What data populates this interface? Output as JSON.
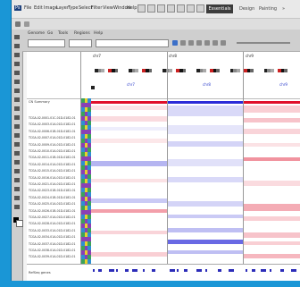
{
  "menubar": {
    "items": [
      "Ps",
      "File",
      "Edit",
      "Image",
      "Layer",
      "Type",
      "Select",
      "Filter",
      "View",
      "Window",
      "Help"
    ],
    "workspace_label": "Essentials",
    "workspace_items": [
      "Design",
      "Painting",
      "»"
    ]
  },
  "toolbar": {
    "tabs": [
      "Genome",
      "Go",
      "Tools",
      "Regions",
      "Help"
    ],
    "locus_value": "",
    "zoom_label": ""
  },
  "doc": {
    "chromosomes": [
      {
        "label": "chr7",
        "link": "chr7"
      },
      {
        "label": "chr8",
        "link": "chr8"
      },
      {
        "label": "chr9",
        "link": "chr9"
      }
    ],
    "cn_label": "CN Summary",
    "samples": [
      "TCGA-02-0001-01C-01D-0182-01",
      "TCGA-02-0003-01A-01D-0182-01",
      "TCGA-02-0006-01B-01D-0182-01",
      "TCGA-02-0007-01A-01D-0182-01",
      "TCGA-02-0009-01A-01D-0182-01",
      "TCGA-02-0010-01A-01D-0182-01",
      "TCGA-02-0011-01B-01D-0182-01",
      "TCGA-02-0014-01A-01D-0182-01",
      "TCGA-02-0015-01A-01D-0182-01",
      "TCGA-02-0016-01A-01D-0182-01",
      "TCGA-02-0021-01A-01D-0182-01",
      "TCGA-02-0023-01B-01D-0182-01",
      "TCGA-02-0024-01B-01D-0182-01",
      "TCGA-02-0025-01A-01D-0182-01",
      "TCGA-02-0026-01B-01D-0182-01",
      "TCGA-02-0027-01A-01D-0182-01",
      "TCGA-02-0028-01A-01D-0182-01",
      "TCGA-02-0033-01A-01D-0182-01",
      "TCGA-02-0034-01A-01D-0182-01",
      "TCGA-02-0037-01A-01D-0182-01",
      "TCGA-02-0038-01A-01D-0182-01",
      "TCGA-02-0039-01A-01D-0182-01"
    ],
    "genes_label": "RefSeq genes"
  },
  "colors": {
    "amplification": "#e0102a",
    "deletion": "#2a2ad8",
    "frame": "#1a96d6"
  }
}
